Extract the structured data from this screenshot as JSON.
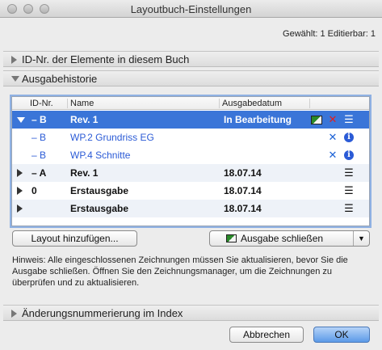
{
  "window": {
    "title": "Layoutbuch-Einstellungen"
  },
  "selection_info": "Gewählt: 1 Editierbar: 1",
  "sections": {
    "id_numbers": "ID-Nr. der Elemente in diesem Buch",
    "history": "Ausgabehistorie",
    "revision_numbering": "Änderungsnummerierung im Index"
  },
  "table": {
    "columns": {
      "id": "ID-Nr.",
      "name": "Name",
      "date": "Ausgabedatum"
    },
    "rows": [
      {
        "id": "– B",
        "name": "Rev. 1",
        "date": "In Bearbeitung",
        "icons": [
          "changes-icon",
          "delete-x-icon",
          "list-icon"
        ]
      },
      {
        "id": "– B",
        "name": "WP.2 Grundriss EG",
        "date": "",
        "icons": [
          "remove-x-icon",
          "info-icon"
        ]
      },
      {
        "id": "– B",
        "name": "WP.4 Schnitte",
        "date": "",
        "icons": [
          "remove-x-icon",
          "info-icon"
        ]
      },
      {
        "id": "– A",
        "name": "Rev. 1",
        "date": "18.07.14",
        "icons": [
          "list-icon"
        ]
      },
      {
        "id": "0",
        "name": "Erstausgabe",
        "date": "18.07.14",
        "icons": [
          "list-icon"
        ]
      },
      {
        "id": "",
        "name": "Erstausgabe",
        "date": "18.07.14",
        "icons": [
          "list-icon"
        ]
      }
    ]
  },
  "buttons": {
    "add_layout": "Layout hinzufügen...",
    "close_issue": "Ausgabe schließen",
    "cancel": "Abbrechen",
    "ok": "OK"
  },
  "hint": "Hinweis: Alle eingeschlossenen Zeichnungen müssen Sie aktualisieren, bevor Sie die Ausgabe schließen. Öffnen Sie den Zeichnungsmanager, um die Zeichnungen zu überprüfen und zu aktualisieren.",
  "colors": {
    "selection": "#3a75d8",
    "link_blue": "#2b5bd6",
    "delete_red": "#e02020"
  }
}
